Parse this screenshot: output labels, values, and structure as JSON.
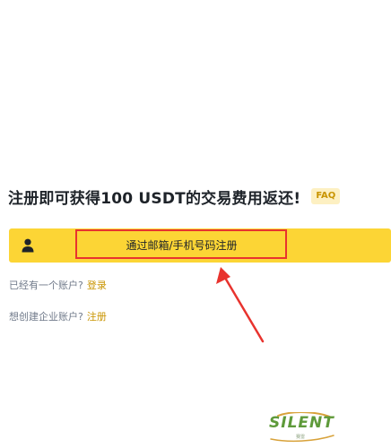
{
  "promo": {
    "headline": "注册即可获得100 USDT的交易费用返还!",
    "faq_label": "FAQ"
  },
  "register": {
    "icon": "user-icon",
    "label": "通过邮箱/手机号码注册"
  },
  "login_prompt": {
    "text": "已经有一个账户?",
    "link": "登录"
  },
  "business_prompt": {
    "text": "想创建企业账户?",
    "link": "注册"
  },
  "annotation": {
    "highlight_color": "#e8332e"
  },
  "watermark": {
    "text": "SILENT",
    "subtext": "赛雷"
  },
  "colors": {
    "brand_yellow": "#fcd535",
    "link_gold": "#c99400",
    "text_dark": "#1e2329",
    "text_muted": "#707a8a"
  }
}
